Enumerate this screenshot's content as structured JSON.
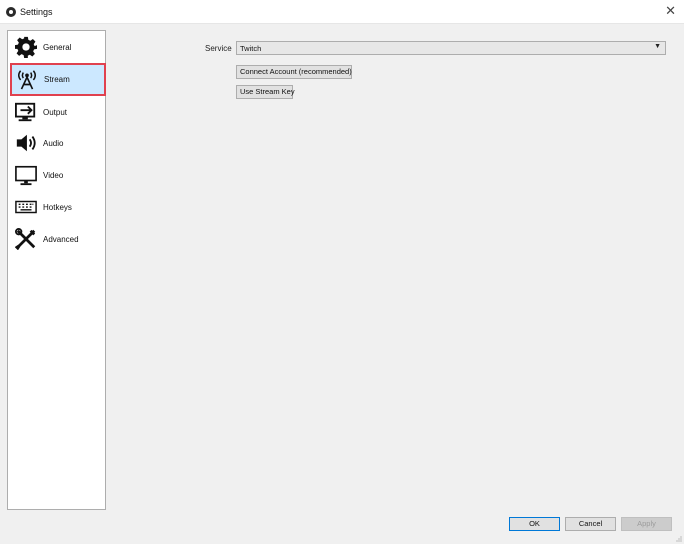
{
  "window": {
    "title": "Settings",
    "close_glyph": "✕"
  },
  "sidebar": {
    "items": [
      {
        "label": "General",
        "icon": "gear-icon"
      },
      {
        "label": "Stream",
        "icon": "antenna-icon",
        "selected": true
      },
      {
        "label": "Output",
        "icon": "output-icon"
      },
      {
        "label": "Audio",
        "icon": "speaker-icon"
      },
      {
        "label": "Video",
        "icon": "monitor-icon"
      },
      {
        "label": "Hotkeys",
        "icon": "keyboard-icon"
      },
      {
        "label": "Advanced",
        "icon": "tools-icon"
      }
    ]
  },
  "stream": {
    "service_label": "Service",
    "service_value": "Twitch",
    "connect_account_label": "Connect Account (recommended)",
    "use_stream_key_label": "Use Stream Key"
  },
  "footer": {
    "ok_label": "OK",
    "cancel_label": "Cancel",
    "apply_label": "Apply"
  },
  "colors": {
    "selected_bg": "#cce8ff",
    "selected_border": "#e0414f",
    "window_bg": "#f0f0f0"
  }
}
